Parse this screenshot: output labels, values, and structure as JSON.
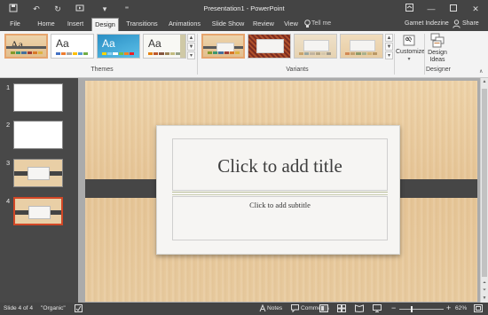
{
  "titlebar": {
    "title": "Presentation1 - PowerPoint",
    "minimize_icon": "minimize-icon",
    "restore_icon": "restore-icon",
    "close_icon": "close-icon"
  },
  "tabs": {
    "items": [
      {
        "label": "File"
      },
      {
        "label": "Home"
      },
      {
        "label": "Insert"
      },
      {
        "label": "Design",
        "active": true
      },
      {
        "label": "Transitions"
      },
      {
        "label": "Animations"
      },
      {
        "label": "Slide Show"
      },
      {
        "label": "Review"
      },
      {
        "label": "View"
      }
    ],
    "tell_me": "Tell me",
    "user_name": "Garnet Indezine",
    "share": "Share"
  },
  "ribbon": {
    "themes_label": "Themes",
    "variants_label": "Variants",
    "designer_label": "Designer",
    "theme_sample": "Aa",
    "customize_label": "Customize",
    "design_ideas_label": "Design Ideas"
  },
  "slides_panel": {
    "numbers": [
      "1",
      "2",
      "3",
      "4"
    ]
  },
  "slide": {
    "title_placeholder": "Click to add title",
    "subtitle_placeholder": "Click to add subtitle"
  },
  "statusbar": {
    "slide_info": "Slide 4 of 4",
    "theme_name": "\"Organic\"",
    "notes": "Notes",
    "comments": "Comments",
    "zoom": "62%",
    "zoom_level": 0.62
  },
  "colors": {
    "accent": "#d24726",
    "chrome_dark": "#444444",
    "ribbon_bg": "#f3f3f3",
    "wood": "#e8cb9f",
    "slide_band": "#464646"
  }
}
